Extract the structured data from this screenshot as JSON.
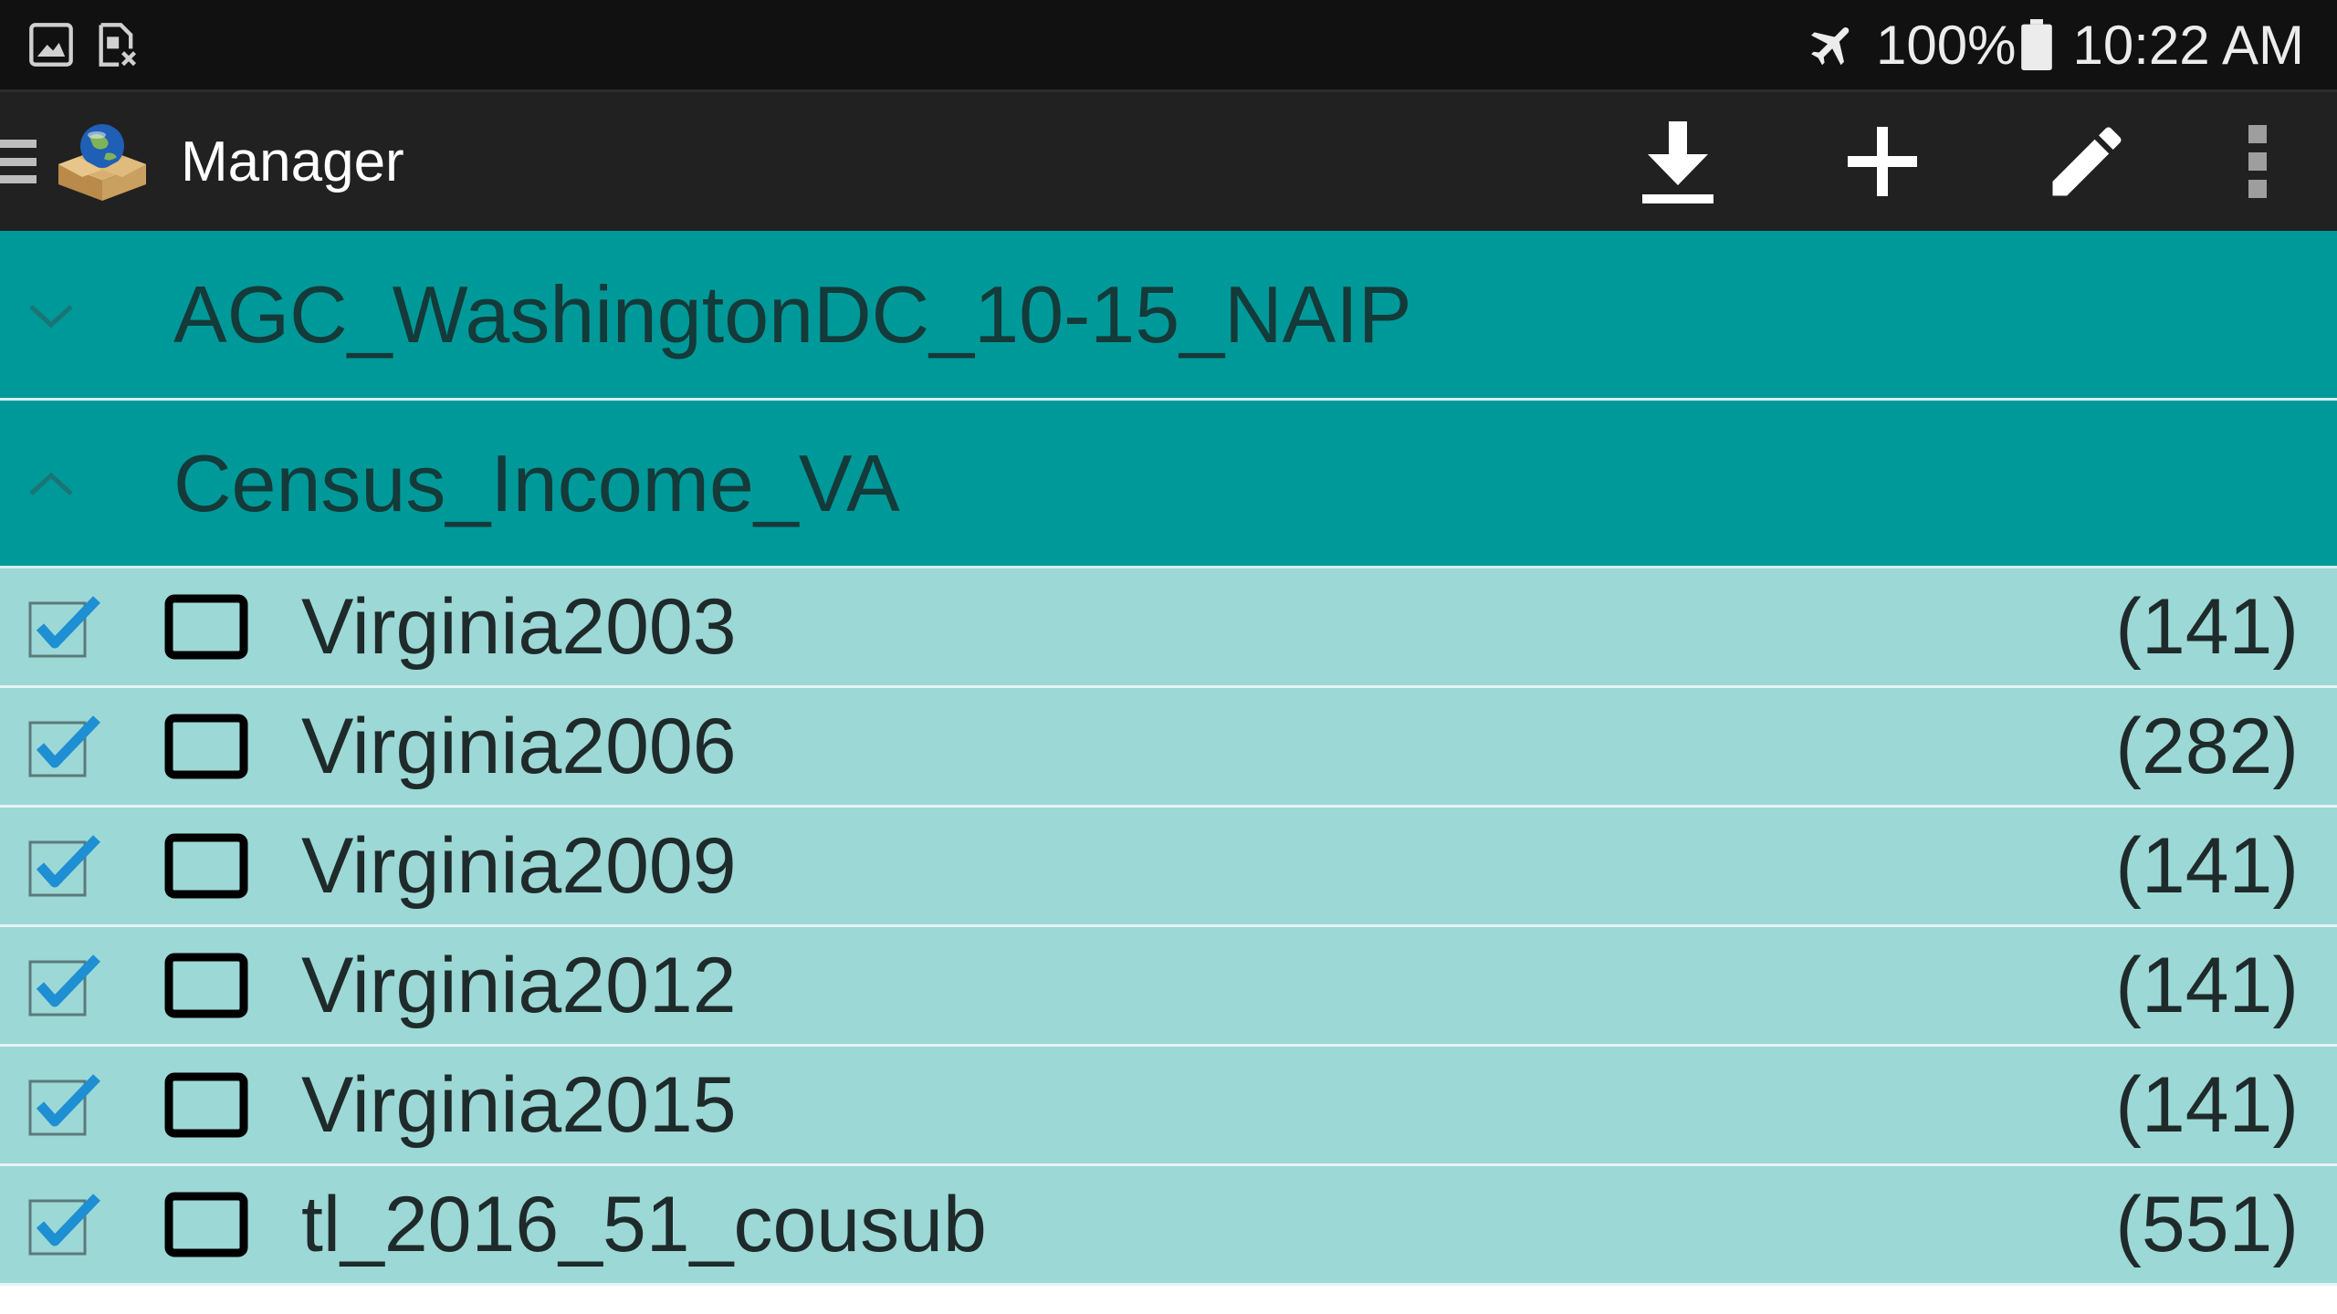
{
  "status_bar": {
    "left_icons": [
      "image-icon",
      "sim-off-icon"
    ],
    "airplane_mode": true,
    "battery_percent": "100%",
    "time": "10:22 AM"
  },
  "app_bar": {
    "title": "Manager",
    "actions": [
      "download-icon",
      "add-icon",
      "edit-icon",
      "overflow-menu-icon"
    ]
  },
  "groups": [
    {
      "title": "AGC_WashingtonDC_10-15_NAIP",
      "expanded": false
    },
    {
      "title": "Census_Income_VA",
      "expanded": true
    }
  ],
  "layers": [
    {
      "name": "Virginia2003",
      "count": "(141)",
      "checked": true
    },
    {
      "name": "Virginia2006",
      "count": "(282)",
      "checked": true
    },
    {
      "name": "Virginia2009",
      "count": "(141)",
      "checked": true
    },
    {
      "name": "Virginia2012",
      "count": "(141)",
      "checked": true
    },
    {
      "name": "Virginia2015",
      "count": "(141)",
      "checked": true
    },
    {
      "name": "tl_2016_51_cousub",
      "count": "(551)",
      "checked": true
    }
  ],
  "colors": {
    "status_bar": "#111111",
    "app_bar": "#212121",
    "group_header": "#009999",
    "child_row": "#9cd8d6",
    "check_accent": "#1e8fd2"
  }
}
